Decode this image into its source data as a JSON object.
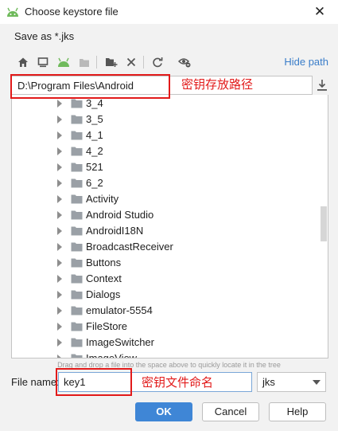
{
  "window": {
    "title": "Choose keystore file"
  },
  "subtitle": "Save as *.jks",
  "toolbar": {
    "icons": [
      "home-icon",
      "desktop-icon",
      "android-icon",
      "folder-icon",
      "new-folder-icon",
      "delete-icon",
      "refresh-icon",
      "show-hidden-icon"
    ],
    "hide_path": "Hide path"
  },
  "path": {
    "value": "D:\\Program Files\\Android"
  },
  "tree": {
    "items": [
      "3_4",
      "3_5",
      "4_1",
      "4_2",
      "521",
      "6_2",
      "Activity",
      "Android Studio",
      "AndroidI18N",
      "BroadcastReceiver",
      "Buttons",
      "Context",
      "Dialogs",
      "emulator-5554",
      "FileStore",
      "ImageSwitcher",
      "ImageView"
    ]
  },
  "hint": "Drag and drop a file into the space above to quickly locate it in the tree",
  "filename": {
    "label": "File name:",
    "value": "key1"
  },
  "extension": {
    "selected": "jks"
  },
  "buttons": {
    "ok": "OK",
    "cancel": "Cancel",
    "help": "Help"
  },
  "annotations": {
    "path_note": "密钥存放路径",
    "name_note": "密钥文件命名",
    "color": "#e21a1a"
  },
  "colors": {
    "accent": "#3f86d6",
    "link": "#3a7dc9",
    "android_green": "#6fba5b"
  }
}
